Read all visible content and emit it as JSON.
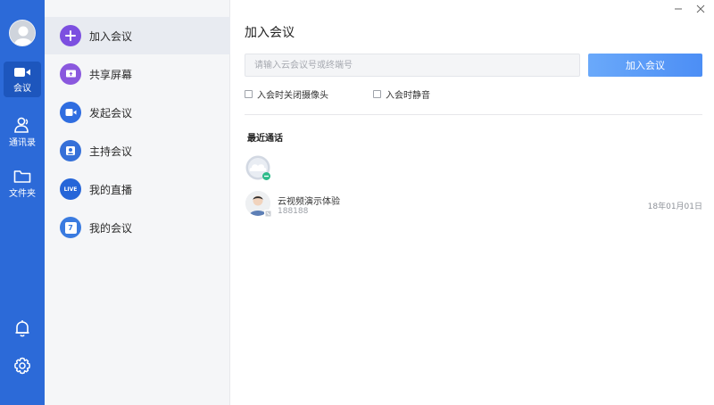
{
  "rail": {
    "items": [
      {
        "label": "会议",
        "icon": "video-camera-icon"
      },
      {
        "label": "通讯录",
        "icon": "contacts-icon"
      },
      {
        "label": "文件夹",
        "icon": "folder-icon"
      }
    ],
    "bottom_icons": [
      "bell-icon",
      "gear-icon"
    ]
  },
  "menu": {
    "items": [
      {
        "label": "加入会议",
        "icon": "plus-icon",
        "color": "#7c4fe0"
      },
      {
        "label": "共享屏幕",
        "icon": "share-screen-icon",
        "color": "#8a58de"
      },
      {
        "label": "发起会议",
        "icon": "video-icon",
        "color": "#2f6de0"
      },
      {
        "label": "主持会议",
        "icon": "host-icon",
        "color": "#3570d8"
      },
      {
        "label": "我的直播",
        "icon": "live-icon",
        "color": "#2565d8",
        "icon_text": "LIVE"
      },
      {
        "label": "我的会议",
        "icon": "calendar-icon",
        "color": "#3a7be0",
        "icon_text": "7"
      }
    ]
  },
  "main": {
    "title": "加入会议",
    "meeting_input": {
      "placeholder": "请输入云会议号或终端号",
      "value": ""
    },
    "join_button": "加入会议",
    "options": [
      {
        "label": "入会时关闭摄像头",
        "checked": false
      },
      {
        "label": "入会时静音",
        "checked": false
      }
    ],
    "recent_title": "最近通话",
    "recent": [
      {
        "name": "云视频演示体验",
        "id": "188188",
        "date": "18年01月01日"
      }
    ]
  },
  "colors": {
    "rail": "#2c6ad8",
    "rail_active": "#1d56bd",
    "menu_bg": "#f5f6f8",
    "menu_active": "#e8ebf1",
    "button": "#4c8ef5"
  }
}
